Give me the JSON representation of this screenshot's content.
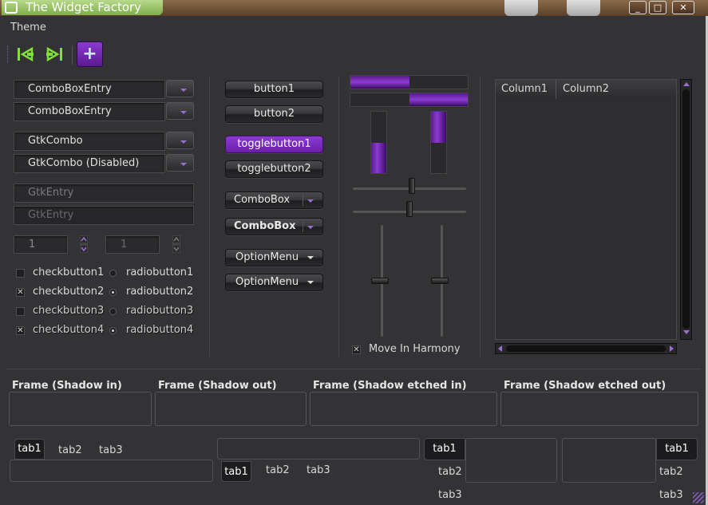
{
  "window": {
    "title": "The Widget Factory",
    "btn_min": "_",
    "btn_max": "□",
    "btn_close": "✕"
  },
  "menu": {
    "theme": "Theme"
  },
  "toolbar": {
    "back_icon": "go-first-icon",
    "forward_icon": "go-last-icon",
    "add_icon": "add-icon",
    "add_glyph": "+"
  },
  "combos": [
    {
      "label": "ComboBoxEntry"
    },
    {
      "label": "ComboBoxEntry"
    },
    {
      "label": "GtkCombo"
    },
    {
      "label": "GtkCombo (Disabled)"
    }
  ],
  "entries": [
    {
      "placeholder": "GtkEntry"
    },
    {
      "placeholder": "GtkEntry"
    }
  ],
  "spins": [
    {
      "value": "1"
    },
    {
      "value": "1"
    }
  ],
  "checks": [
    {
      "label": "checkbutton1",
      "checked": false,
      "radio": "radiobutton1",
      "radio_on": false
    },
    {
      "label": "checkbutton2",
      "checked": true,
      "radio": "radiobutton2",
      "radio_on": true
    },
    {
      "label": "checkbutton3",
      "checked": false,
      "radio": "radiobutton3",
      "radio_on": false
    },
    {
      "label": "checkbutton4",
      "checked": true,
      "radio": "radiobutton4",
      "radio_on": true
    }
  ],
  "check_mark": "✕",
  "buttons": {
    "button1": "button1",
    "button2": "button2",
    "toggle1": "togglebutton1",
    "toggle2": "togglebutton2",
    "combobox1": "ComboBox",
    "combobox2": "ComboBox",
    "option1": "OptionMenu",
    "option2": "OptionMenu"
  },
  "progress": {
    "h1": 0.5,
    "h2": 0.5,
    "v1": 0.5,
    "v2": 0.5
  },
  "sliders": {
    "h1": 0.52,
    "h2": 0.5,
    "v1": 0.5,
    "v2": 0.5
  },
  "harmony": {
    "label": "Move In Harmony",
    "checked": true
  },
  "tree": {
    "columns": [
      "Column1",
      "Column2"
    ]
  },
  "frames": [
    {
      "title": "Frame (Shadow in)"
    },
    {
      "title": "Frame (Shadow out)"
    },
    {
      "title": "Frame (Shadow etched in)"
    },
    {
      "title": "Frame (Shadow etched out)"
    }
  ],
  "notebooks": {
    "tabs": [
      "tab1",
      "tab2",
      "tab3"
    ]
  },
  "colors": {
    "accent": "#8b3bd0",
    "window_bg": "#333336",
    "title_green": "#9cc96a"
  }
}
